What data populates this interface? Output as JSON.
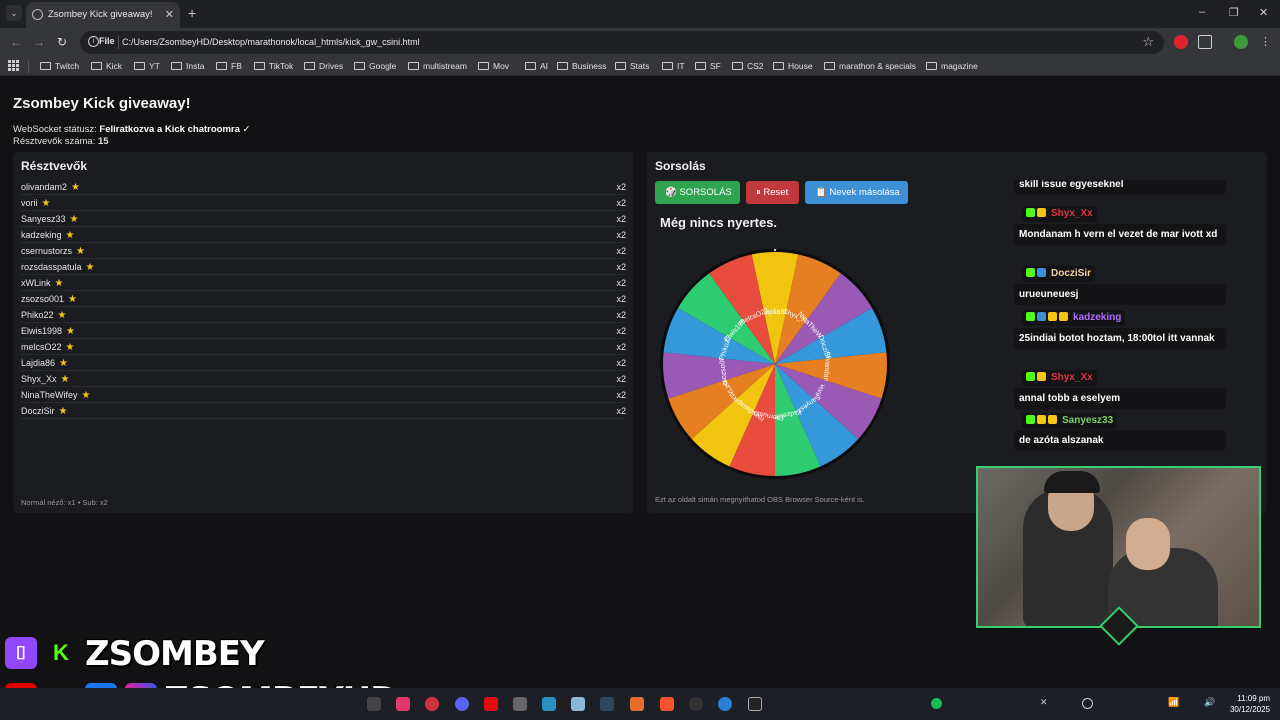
{
  "browser": {
    "tab_title": "Zsombey Kick giveaway!",
    "new_tab": "+",
    "window_controls": [
      "–",
      "❐",
      "✕"
    ],
    "url_scheme": "File",
    "url": "C:/Users/ZsombeyHD/Desktop/marathonok/local_htmls/kick_gw_csini.html",
    "bookmarks": [
      "Twitch",
      "Kick",
      "YT",
      "Insta",
      "FB",
      "TikTok",
      "Drives",
      "Google",
      "multistream",
      "Mov",
      "AI",
      "Business",
      "Stats",
      "IT",
      "SF",
      "CS2",
      "House",
      "marathon & specials",
      "magazine"
    ]
  },
  "page": {
    "title": "Zsombey Kick giveaway!",
    "ws_label": "WebSocket státusz:",
    "ws_value": "Feliratkozva a Kick chatroomra ✓",
    "count_label": "Résztvevők száma:",
    "count_value": "15"
  },
  "participants": {
    "title": "Résztvevők",
    "items": [
      {
        "name": "olivandam2",
        "mult": "x2"
      },
      {
        "name": "vorii",
        "mult": "x2"
      },
      {
        "name": "Sanyesz33",
        "mult": "x2"
      },
      {
        "name": "kadzeking",
        "mult": "x2"
      },
      {
        "name": "csernustorzs",
        "mult": "x2"
      },
      {
        "name": "rozsdasspatula",
        "mult": "x2"
      },
      {
        "name": "xWLink",
        "mult": "x2"
      },
      {
        "name": "zsozso001",
        "mult": "x2"
      },
      {
        "name": "Phiko22",
        "mult": "x2"
      },
      {
        "name": "Elwis1998",
        "mult": "x2"
      },
      {
        "name": "melcsO22",
        "mult": "x2"
      },
      {
        "name": "Lajdia86",
        "mult": "x2"
      },
      {
        "name": "Shyx_Xx",
        "mult": "x2"
      },
      {
        "name": "NinaTheWifey",
        "mult": "x2"
      },
      {
        "name": "DocziSir",
        "mult": "x2"
      }
    ],
    "legend": "Normál néző: x1 • Sub: x2"
  },
  "draw": {
    "title": "Sorsolás",
    "draw_button": "🎲 SORSOLÁS",
    "reset_button": "⏸ Reset",
    "copy_button": "📋 Nevek másolása",
    "winner_text": "Még nincs nyertes.",
    "obs_note": "Ezt az oldalt simán megnyithatod OBS Browser Source-ként is.",
    "wheel_labels": [
      "Lajdia86",
      "Shyx_Xx",
      "NinaTheWifey",
      "DocziSir",
      "olivandam2",
      "vorii",
      "Sanyesz33",
      "kadzeking",
      "csernustorzs",
      "rozsdasspatula",
      "xWLink",
      "zsozso001",
      "Phiko22",
      "Elwis1998",
      "melcsO22"
    ],
    "wheel_colors": [
      "#f1c40f",
      "#e67e22",
      "#9b59b6",
      "#3498db",
      "#e67e22",
      "#9b59b6",
      "#3498db",
      "#2ecc71",
      "#e74c3c",
      "#f1c40f",
      "#e67e22",
      "#9b59b6",
      "#3498db",
      "#2ecc71",
      "#e74c3c"
    ]
  },
  "chat": [
    {
      "user": null,
      "text": "skill issue egyeseknel"
    },
    {
      "user": "Shyx_Xx",
      "user_color": "#e0364a",
      "text": "Mondanam h vern el vezet de mar ivott xd"
    },
    {
      "user": "DocziSir",
      "user_color": "#f2d3a0",
      "text": "urueuneuesj"
    },
    {
      "user": "kadzeking",
      "user_color": "#b36cff",
      "text": "25indiai botot hoztam, 18:00tol itt vannak"
    },
    {
      "user": "Shyx_Xx",
      "user_color": "#e0364a",
      "text": "annal tobb a eselyem"
    },
    {
      "user": "Sanyesz33",
      "user_color": "#7bd36a",
      "text": "de azóta alszanak"
    }
  ],
  "branding": {
    "line1": "ZSOMBEY",
    "line2": "ZSOMBEYHD"
  },
  "taskbar": {
    "time": "11:09 pm",
    "date": "30/12/2025"
  }
}
